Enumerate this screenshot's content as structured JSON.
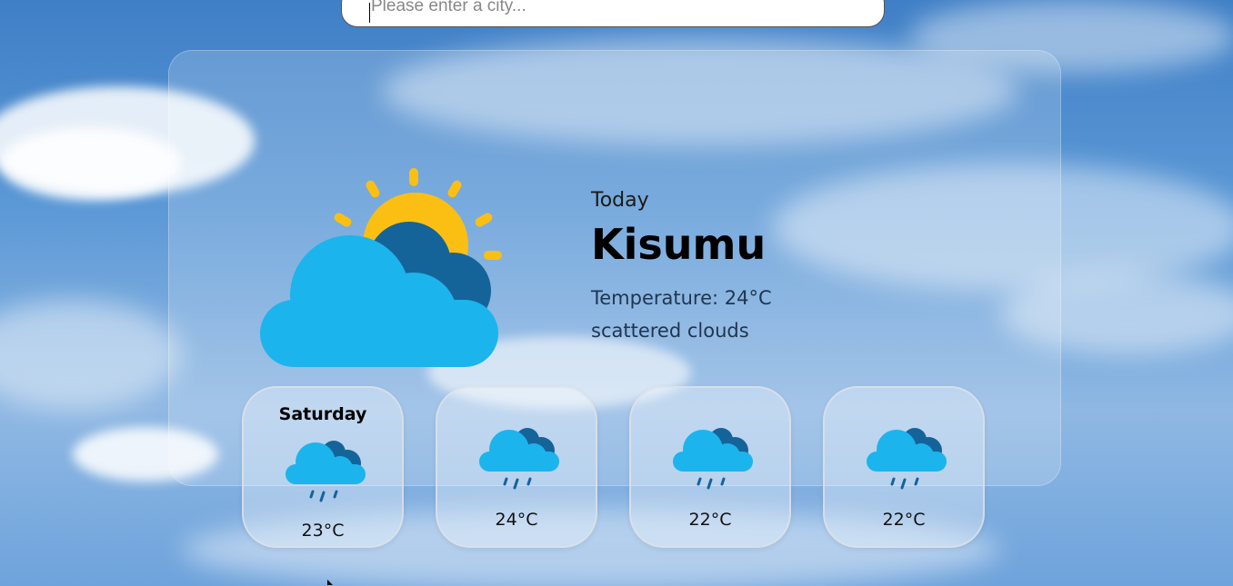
{
  "search": {
    "placeholder": "Please enter a city..."
  },
  "current": {
    "label": "Today",
    "city": "Kisumu",
    "temperature": "Temperature: 24°C",
    "description": "scattered clouds",
    "icon": "partly-cloudy-sun-icon"
  },
  "forecast": [
    {
      "day": "Saturday",
      "temp": "23°C",
      "icon": "rain-cloud-icon"
    },
    {
      "day": "",
      "temp": "24°C",
      "icon": "rain-cloud-icon"
    },
    {
      "day": "",
      "temp": "22°C",
      "icon": "rain-cloud-icon"
    },
    {
      "day": "",
      "temp": "22°C",
      "icon": "rain-cloud-icon"
    }
  ],
  "colors": {
    "sun": "#fbbf14",
    "cloud_front": "#1cb4ec",
    "cloud_back": "#14649a",
    "rain": "#14649a"
  }
}
